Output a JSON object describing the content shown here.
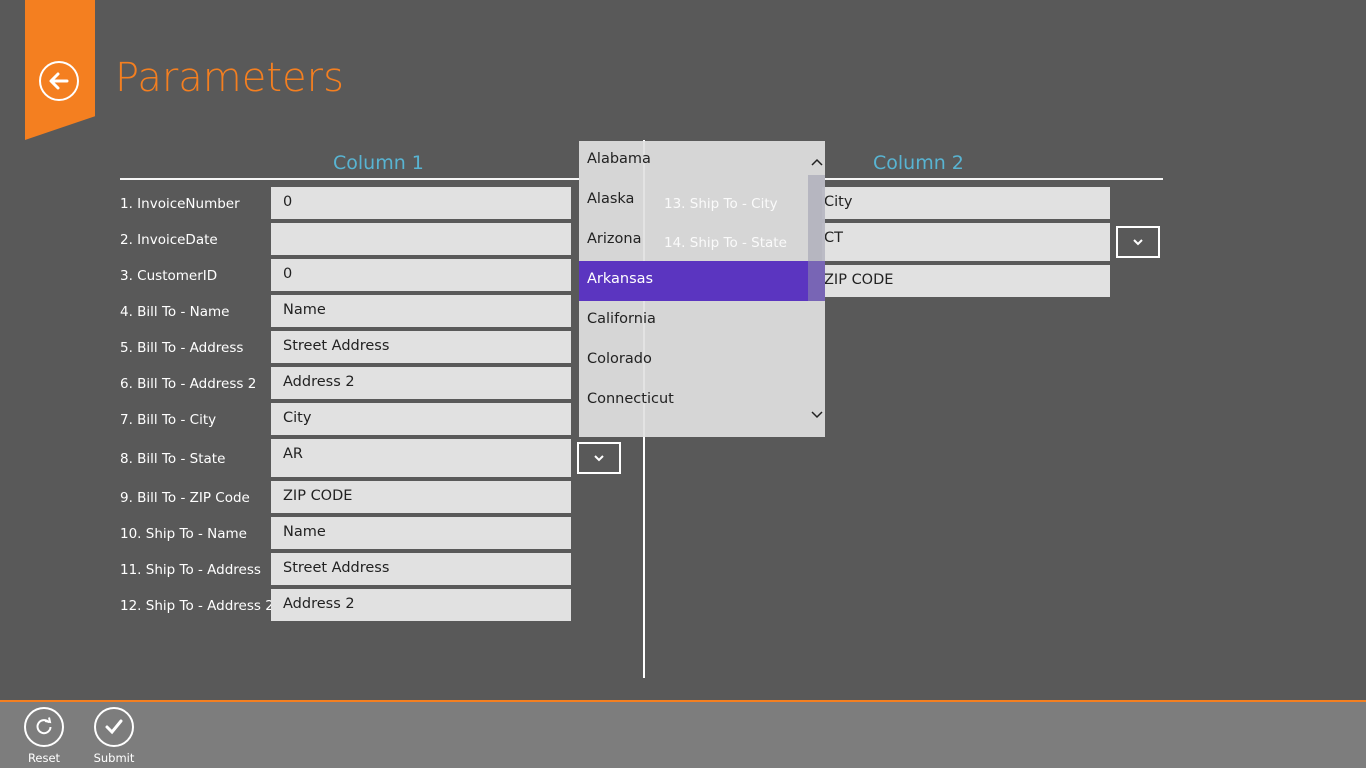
{
  "page": {
    "title": "Parameters"
  },
  "column1": {
    "header": "Column 1",
    "fields": [
      {
        "label": "1. InvoiceNumber",
        "value": "0"
      },
      {
        "label": "2. InvoiceDate",
        "value": ""
      },
      {
        "label": "3. CustomerID",
        "value": "0"
      },
      {
        "label": "4. Bill To - Name",
        "value": "Name"
      },
      {
        "label": "5. Bill To - Address",
        "value": "Street Address"
      },
      {
        "label": "6. Bill To - Address 2",
        "value": "Address 2"
      },
      {
        "label": "7. Bill To - City",
        "value": "City"
      },
      {
        "label": "8. Bill To - State",
        "value": "AR"
      },
      {
        "label": "9. Bill To - ZIP Code",
        "value": "ZIP CODE"
      },
      {
        "label": "10. Ship To - Name",
        "value": "Name"
      },
      {
        "label": "11. Ship To - Address",
        "value": "Street Address"
      },
      {
        "label": "12. Ship To - Address 2",
        "value": "Address 2"
      }
    ]
  },
  "column2": {
    "header": "Column 2",
    "fields": [
      {
        "label": "13. Ship To - City",
        "value": "City"
      },
      {
        "label": "14. Ship To - State",
        "value": "CT"
      },
      {
        "label": "",
        "value": "ZIP CODE"
      }
    ]
  },
  "state_dropdown": {
    "options": [
      "Alabama",
      "Alaska",
      "Arizona",
      "Arkansas",
      "California",
      "Colorado",
      "Connecticut"
    ],
    "selected": "Arkansas"
  },
  "app_bar": {
    "reset_label": "Reset",
    "submit_label": "Submit"
  },
  "icons": {
    "back": "back-arrow-icon",
    "dropdown": "chevron-down-icon",
    "reset": "refresh-icon",
    "submit": "checkmark-icon"
  },
  "colors": {
    "accent": "#f47f20",
    "header": "#58b4d2",
    "selection": "#5b35c0",
    "background": "#595959"
  }
}
